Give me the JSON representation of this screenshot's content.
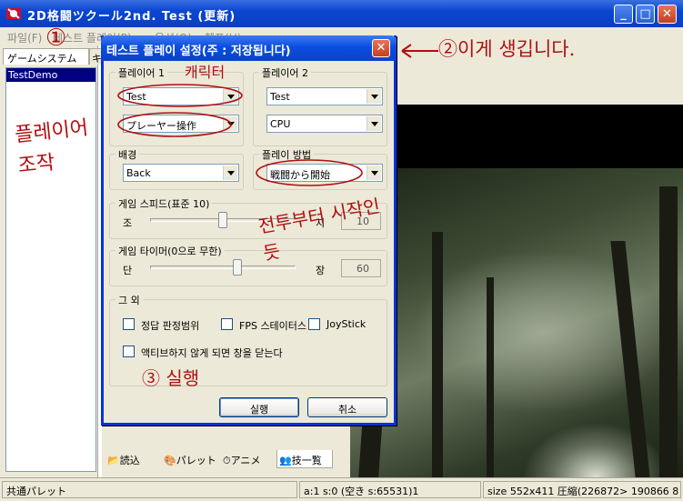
{
  "app": {
    "title": "2D格闘ツクール2nd.  Test (更新)",
    "minimize_glyph": "_",
    "maximize_glyph": "□",
    "close_glyph": "✕",
    "icon": "app-icon"
  },
  "menu": {
    "items": [
      "파일(F)",
      "테스트 플레이(P)",
      "옵션(O)",
      "헬프(H)"
    ]
  },
  "left_panel": {
    "tab_label": "ゲームシステム",
    "tab2_label": "キ",
    "list_items": [
      "TestDemo"
    ]
  },
  "dialog": {
    "title": "테스트 플레이 설정(주 : 저장됩니다)",
    "close_glyph": "✕",
    "player1": {
      "label": "플레이어 1",
      "character": "Test",
      "control": "プレーヤー操作"
    },
    "player2": {
      "label": "플레이어 2",
      "character": "Test",
      "control": "CPU"
    },
    "background": {
      "label": "배경",
      "value": "Back"
    },
    "play_method": {
      "label": "플레이 방법",
      "value": "戦闘から開始"
    },
    "game_speed": {
      "label": "게임 스피드(표준 10)",
      "left_label": "조",
      "right_label": "지",
      "value": "10",
      "level": 0.5
    },
    "game_timer": {
      "label": "게임 타이머(0으로 무한)",
      "left_label": "단",
      "right_label": "장",
      "value": "60",
      "level": 0.6
    },
    "other": {
      "label": "그 외",
      "checkboxes": [
        {
          "label": "정답 판정범위",
          "checked": false
        },
        {
          "label": "FPS 스테이터스",
          "checked": false
        },
        {
          "label": "JoyStick",
          "checked": false
        },
        {
          "label": "액티브하지 않게 되면 창을 닫는다",
          "checked": false
        }
      ]
    },
    "run_label": "실행",
    "cancel_label": "취소"
  },
  "bottom_tabs": [
    {
      "label": "読込",
      "icon": "folder-open-icon"
    },
    {
      "label": "パレット",
      "icon": "palette-icon"
    },
    {
      "label": "アニメ",
      "icon": "animation-icon"
    },
    {
      "label": "技一覧",
      "icon": "moves-list-icon"
    }
  ],
  "status": {
    "left": "共通パレット",
    "middle": "a:1 s:0 (空き s:65531)1",
    "right": "size 552x411 圧縮(226872> 190866 8"
  },
  "annotations": {
    "top_left_number": "①",
    "dialog_note": "②이게 생깁니다.",
    "p1_char_note": "캐릭터",
    "p1_control_note": "플레이어 조작",
    "play_method_note": "전투부터 시작인듯",
    "run_note": "③ 실행"
  },
  "colors": {
    "title_blue": "#0a46d2",
    "dialog_face": "#ece9d8",
    "annotation_red": "#b01010",
    "selection": "#000080"
  }
}
